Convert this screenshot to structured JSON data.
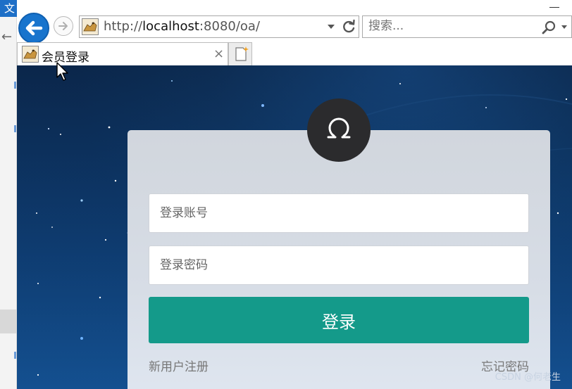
{
  "background_window": {
    "menu_label": "文"
  },
  "browser": {
    "url": {
      "prefix": "http://",
      "host": "localhost",
      "rest": ":8080/oa/"
    },
    "search": {
      "placeholder": "搜索..."
    },
    "tab": {
      "title": "会员登录",
      "close": "×"
    }
  },
  "page": {
    "login": {
      "account_placeholder": "登录账号",
      "password_placeholder": "登录密码",
      "submit_label": "登录",
      "register_link": "新用户注册",
      "forgot_link": "忘记密码"
    },
    "watermark": "CSDN @何老生"
  },
  "colors": {
    "accent": "#149a8a",
    "back_button": "#1874cd",
    "avatar_bg": "#2b2b2d",
    "sky_dark": "#04142a",
    "sky_light": "#10417a"
  }
}
